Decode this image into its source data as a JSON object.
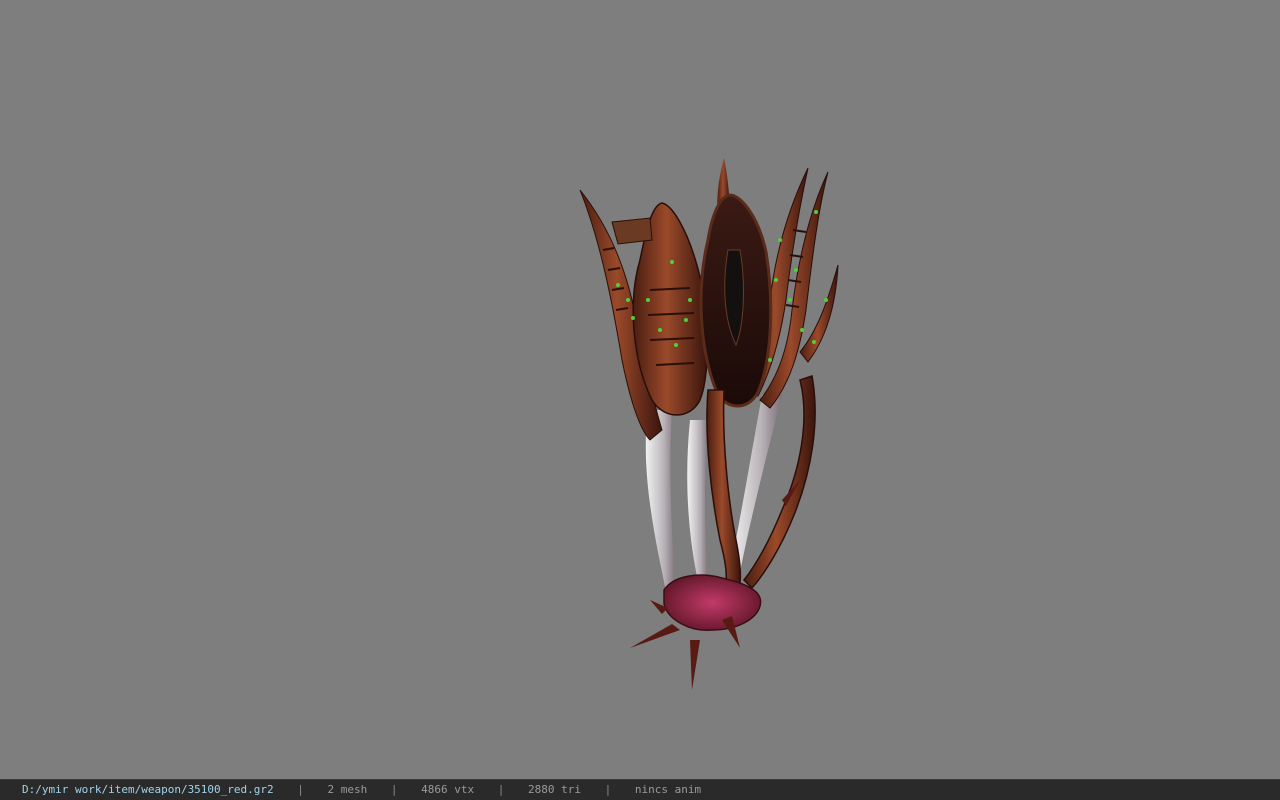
{
  "viewer": {
    "background_color": "#7e7e7e",
    "model_icon": "spiked-claw-weapon-3d-model"
  },
  "status": {
    "file_path": "D:/ymir work/item/weapon/35100_red.gr2",
    "meshes": "2 mesh",
    "vertices": "4866 vtx",
    "triangles": "2880 tri",
    "animation": "nincs anim",
    "separator": "|"
  }
}
